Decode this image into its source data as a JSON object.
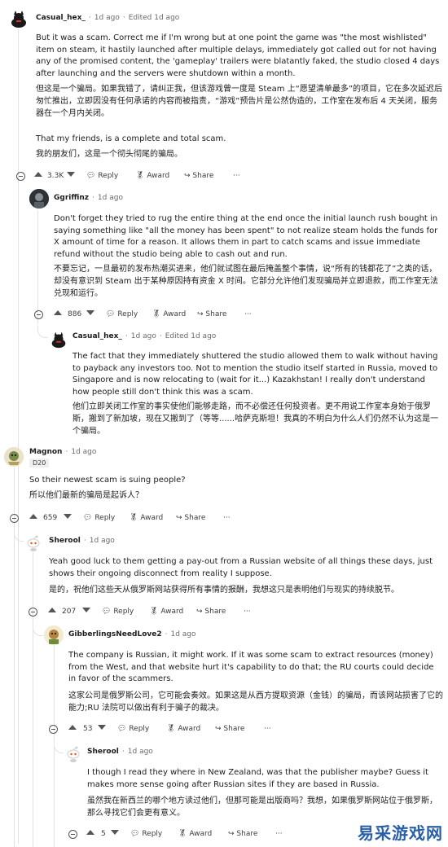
{
  "comments": [
    {
      "id": "c1",
      "username": "Casual_hex_",
      "time": "1d ago",
      "edited": "Edited 1d ago",
      "text_en_1": "But it was a scam. Correct me if I'm wrong but at one point the game was \"the most wishlisted\" item on steam, it hastily launched after multiple delays, immediately got called out for not having any of the promised content, the 'gameplay' trailers were blatantly faked, the studio closed 4 days after launching and the servers were shutdown within a month.",
      "text_zh_1": "但这是一个骗局。如果我错了，请纠正我，但该游戏曾一度是 Steam 上“愿望清单最多”的项目，它在多次延迟后匆忙推出，立即因没有任何承诺的内容而被指责，“游戏”预告片是公然伪造的，工作室在发布后 4 天关闭，服务器在一个月内关闭。",
      "text_en_2": "That my friends, is a complete and total scam.",
      "text_zh_2": "我的朋友们，这是一个彻头彻尾的骗局。",
      "votes": "3.3K",
      "reply": "Reply",
      "award": "Award",
      "share": "Share",
      "more": "···"
    },
    {
      "id": "c2",
      "username": "Ggriffinz",
      "time": "1d ago",
      "text_en": "Don't forget they tried to rug the entire thing at the end once the initial launch rush bought in saying something like \"all the money has been spent\" to not realize steam holds the funds for X amount of time for a reason. It allows them in part to catch scams and issue immediate refund without the studio being able to cash out and run.",
      "text_zh": "不要忘记，一旦最初的发布热潮买进来，他们就试图在最后掩盖整个事情，说“所有的钱都花了”之类的话，却没有意识到 Steam 出于某种原因持有资金 X 时间。它部分允许他们发现骗局并立即退款，而工作室无法兑现和运行。",
      "votes": "886",
      "reply": "Reply",
      "award": "Award",
      "share": "Share",
      "more": "···"
    },
    {
      "id": "c3",
      "username": "Casual_hex_",
      "time": "1d ago",
      "edited": "Edited 1d ago",
      "text_en": "The fact that they immediately shuttered the studio allowed them to walk without having to payback any investors too. Not to mention the studio itself started in Russia, moved to Singapore and is now relocating to (wait for it...) Kazakhstan! I really don't understand how people still don't think this was a scam.",
      "text_zh": "他们立即关闭工作室的事实使他们能够走路，而不必偿还任何投资者。更不用说工作室本身始于俄罗斯，搬到了新加坡，现在又搬到了（等等......哈萨克斯坦！我真的不明白为什么人们仍然不认为这是一个骗局。"
    },
    {
      "id": "c4",
      "username": "Magnon",
      "time": "1d ago",
      "flair": "D20",
      "text_en": "So their newest scam is suing people?",
      "text_zh": "所以他们最新的骗局是起诉人？",
      "votes": "659",
      "reply": "Reply",
      "award": "Award",
      "share": "Share",
      "more": "···"
    },
    {
      "id": "c5",
      "username": "Sherool",
      "time": "1d ago",
      "text_en": "Yeah good luck to them getting a pay-out from a Russian website of all things these days, just shows their ongoing disconnect from reality I suppose.",
      "text_zh": "是的，祝他们这些天从俄罗斯网站获得所有事情的报酬，我想这只是表明他们与现实的持续脱节。",
      "votes": "207",
      "reply": "Reply",
      "award": "Award",
      "share": "Share",
      "more": "···"
    },
    {
      "id": "c6",
      "username": "GibberlingsNeedLove2",
      "time": "1d ago",
      "text_en": "The company is Russian, it might work. If it was some scam to extract resources (money) from the West, and that website hurt it's capability to do that; the RU courts could decide in favor of the scammers.",
      "text_zh": "这家公司是俄罗斯公司，它可能会奏效。如果这是从西方提取资源（金钱）的骗局，而该网站损害了它的能力;RU 法院可以做出有利于骗子的裁决。",
      "votes": "53",
      "reply": "Reply",
      "award": "Award",
      "share": "Share",
      "more": "···"
    },
    {
      "id": "c7",
      "username": "Sherool",
      "time": "1d ago",
      "text_en": "I though I read they where in New Zealand, was that the publisher maybe? Guess it makes more sense going after Russian sites if they are based in Russia.",
      "text_zh": "虽然我在新西兰的哪个地方读过他们，但那可能是出版商吗？我想，如果俄罗斯网站位于俄罗斯，那么寻找它们会更有意义。",
      "votes": "5",
      "reply": "Reply",
      "award": "Award",
      "share": "Share",
      "more": "···"
    }
  ],
  "watermark": "易采游戏网",
  "colors": {
    "text": "#1c1c1c",
    "meta": "#6b6b6b",
    "thread": "#e2e2e2",
    "watermark": "#2a5fa8"
  }
}
